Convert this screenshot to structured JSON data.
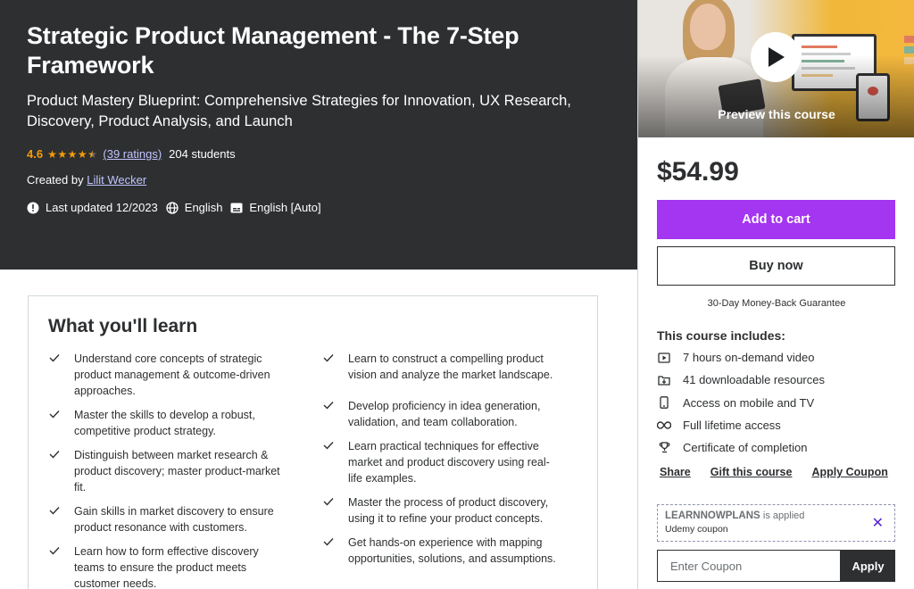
{
  "hero": {
    "title": "Strategic Product Management - The 7-Step Framework",
    "subtitle": "Product Mastery Blueprint: Comprehensive Strategies for Innovation, UX Research, Discovery, Product Analysis, and Launch",
    "rating": "4.6",
    "rating_stars": 4.5,
    "ratings_link": "(39 ratings)",
    "students": "204 students",
    "created_prefix": "Created by",
    "author": "Lilit Wecker",
    "last_updated": "Last updated 12/2023",
    "language": "English",
    "captions": "English [Auto]"
  },
  "sidebar": {
    "preview_label": "Preview this course",
    "price": "$54.99",
    "add_to_cart": "Add to cart",
    "buy_now": "Buy now",
    "guarantee": "30-Day Money-Back Guarantee",
    "includes_title": "This course includes:",
    "includes": [
      {
        "icon": "video-icon",
        "label": "7 hours on-demand video"
      },
      {
        "icon": "download-icon",
        "label": "41 downloadable resources"
      },
      {
        "icon": "mobile-icon",
        "label": "Access on mobile and TV"
      },
      {
        "icon": "infinity-icon",
        "label": "Full lifetime access"
      },
      {
        "icon": "trophy-icon",
        "label": "Certificate of completion"
      }
    ],
    "links": {
      "share": "Share",
      "gift": "Gift this course",
      "apply_coupon": "Apply Coupon"
    },
    "coupon": {
      "code": "LEARNNOWPLANS",
      "applied_text": "is applied",
      "sub": "Udemy coupon",
      "input_placeholder": "Enter Coupon",
      "apply_button": "Apply"
    }
  },
  "learn": {
    "title": "What you'll learn",
    "left": [
      "Understand core concepts of strategic product management & outcome-driven approaches.",
      "Master the skills to develop a robust, competitive product strategy.",
      "Distinguish between market research & product discovery; master product-market fit.",
      "Gain skills in market discovery to ensure product resonance with customers.",
      "Learn how to form effective discovery teams to ensure the product meets customer needs."
    ],
    "right": [
      "Learn to construct a compelling product vision and analyze the market landscape.",
      "Develop proficiency in idea generation, validation, and team collaboration.",
      "Learn practical techniques for effective market and product discovery using real-life examples.",
      "Master the process of product discovery, using it to refine your product concepts.",
      "Get hands-on experience with mapping opportunities, solutions, and assumptions."
    ]
  },
  "colors": {
    "hero_bg": "#2d2f31",
    "accent_purple": "#a435f0",
    "star_orange": "#f69c08",
    "link_lavender": "#c0c4fc",
    "coupon_x": "#5624d0"
  }
}
